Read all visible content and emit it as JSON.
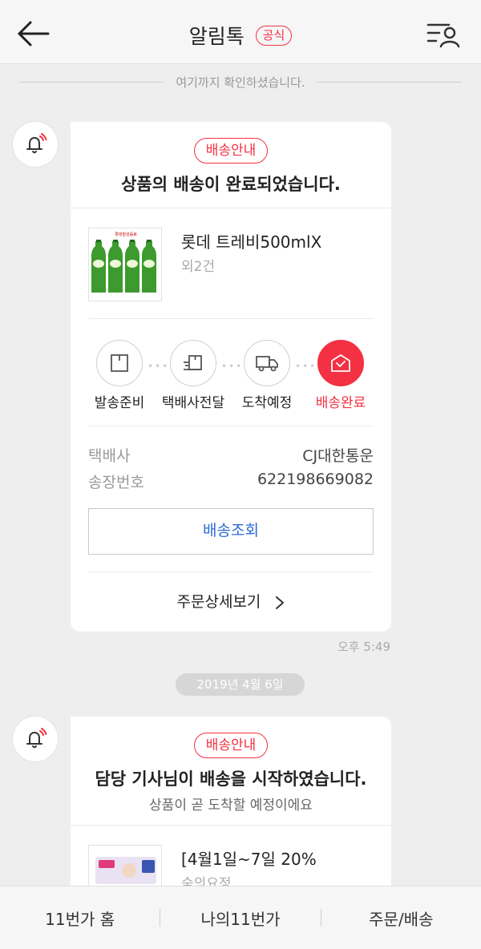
{
  "header": {
    "title": "알림톡",
    "badge": "공식",
    "back_icon": "arrow-left-icon",
    "menu_icon": "list-person-icon"
  },
  "read_divider": "여기까지 확인하셨습니다.",
  "messages": [
    {
      "tag": "배송안내",
      "title": "상품의 배송이 완료되었습니다.",
      "product": {
        "name": "롯데 트레비500mlX",
        "extra": "외2건",
        "thumb_label": "TREVI"
      },
      "steps": [
        {
          "label": "발송준비",
          "icon": "box-icon",
          "active": false
        },
        {
          "label": "택배사전달",
          "icon": "box-handoff-icon",
          "active": false
        },
        {
          "label": "도착예정",
          "icon": "truck-icon",
          "active": false
        },
        {
          "label": "배송완료",
          "icon": "house-check-icon",
          "active": true
        }
      ],
      "courier_label": "택배사",
      "courier_value": "CJ대한통운",
      "invoice_label": "송장번호",
      "invoice_value": "622198669082",
      "track_button": "배송조회",
      "detail_link": "주문상세보기",
      "time": "오후 5:49"
    },
    {
      "tag": "배송안내",
      "title": "담당 기사님이 배송을 시작하였습니다.",
      "subtitle": "상품이 곧 도착할 예정이에요",
      "product": {
        "name": "[4월1일~7일 20%",
        "extra": "숲의요정"
      }
    }
  ],
  "date_separator": "2019년 4월 6일",
  "bottom_nav": [
    "11번가 홈",
    "나의11번가",
    "주문/배송"
  ],
  "colors": {
    "accent": "#f43142",
    "link": "#2b6bd6",
    "background": "#eeeeee"
  }
}
